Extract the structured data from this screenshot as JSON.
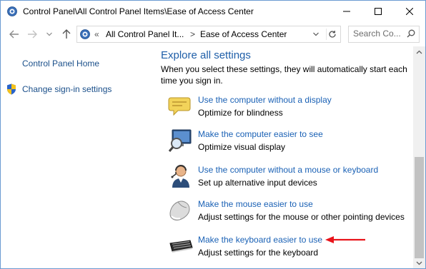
{
  "window": {
    "title": "Control Panel\\All Control Panel Items\\Ease of Access Center",
    "app_icon": "control-panel-icon",
    "controls": [
      "minimize-icon",
      "maximize-icon",
      "close-icon"
    ]
  },
  "nav": {
    "back_icon": "arrow-left-icon",
    "forward_icon": "arrow-right-icon",
    "recent_icon": "chevron-down-icon",
    "up_icon": "arrow-up-icon"
  },
  "address": {
    "overflow": "«",
    "crumbs": [
      "All Control Panel It...",
      "Ease of Access Center"
    ],
    "separator": ">",
    "refresh_icon": "refresh-icon"
  },
  "search": {
    "placeholder": "Search Co...",
    "icon": "search-icon"
  },
  "left_pane": {
    "home": "Control Panel Home",
    "signin": "Change sign-in settings",
    "signin_icon": "shield-icon"
  },
  "main": {
    "heading": "Explore all settings",
    "description": "When you select these settings, they will automatically start each time you sign in.",
    "items": [
      {
        "link": "Use the computer without a display",
        "sub": "Optimize for blindness",
        "icon": "speech-bubble-icon"
      },
      {
        "link": "Make the computer easier to see",
        "sub": "Optimize visual display",
        "icon": "magnifier-monitor-icon"
      },
      {
        "link": "Use the computer without a mouse or keyboard",
        "sub": "Set up alternative input devices",
        "icon": "person-headset-icon"
      },
      {
        "link": "Make the mouse easier to use",
        "sub": "Adjust settings for the mouse or other pointing devices",
        "icon": "mouse-icon"
      },
      {
        "link": "Make the keyboard easier to use",
        "sub": "Adjust settings for the keyboard",
        "icon": "keyboard-icon"
      }
    ]
  },
  "annotation": {
    "icon": "red-arrow-icon",
    "color": "#e8141b"
  },
  "colors": {
    "link": "#1a61b5",
    "heading": "#1e5ea8",
    "border": "#6b9bd2"
  }
}
